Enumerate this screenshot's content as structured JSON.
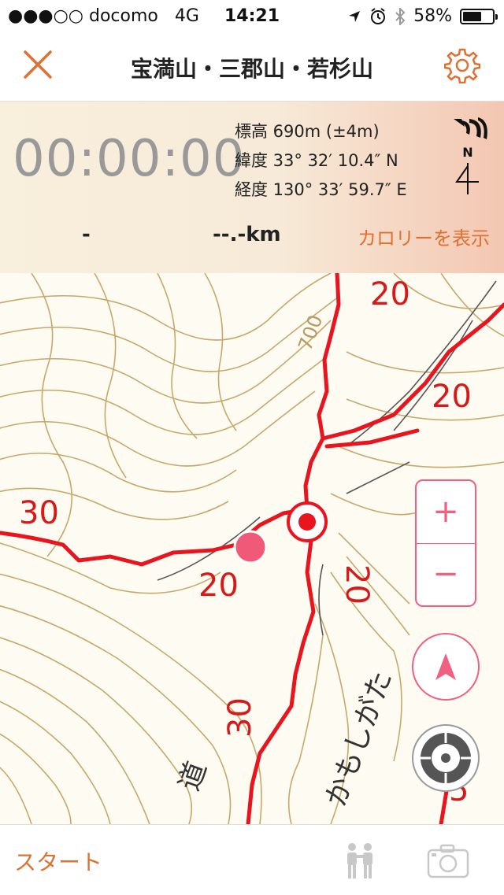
{
  "status": {
    "carrier": "●●●○○ docomo",
    "network": "4G",
    "time": "14:21",
    "battery": "58%",
    "battery_level": 0.58
  },
  "nav": {
    "title": "宝満山・三郡山・若杉山",
    "close_icon": "close-icon",
    "settings_icon": "gear-icon"
  },
  "info": {
    "timer": "00:00:00",
    "elevation": "標高 690m (±4m)",
    "latitude": "緯度 33° 32′ 10.4″ N",
    "longitude": "経度 130° 33′ 59.7″ E",
    "compass_label": "N",
    "stat_left": "-",
    "distance": "--.-km",
    "calorie_button": "カロリーを表示"
  },
  "map": {
    "labels": [
      "20",
      "20",
      "30",
      "20",
      "20",
      "30",
      "700",
      "かもしがた",
      "道",
      "5"
    ],
    "zoom_in": "+",
    "zoom_out": "−",
    "accent": "#f06080",
    "trail_color": "#e8141e",
    "contour_color": "#c8a86a"
  },
  "bottom": {
    "start": "スタート",
    "people_icon": "people-icon",
    "camera_icon": "camera-icon"
  }
}
